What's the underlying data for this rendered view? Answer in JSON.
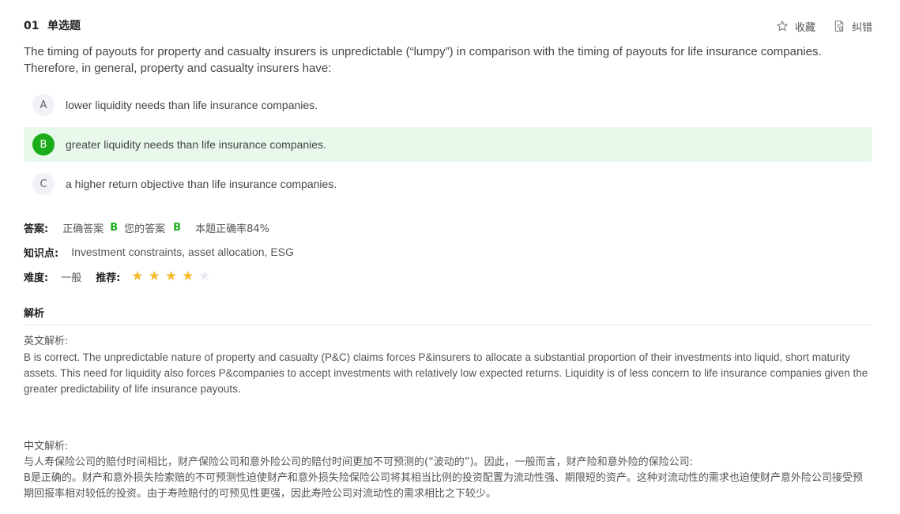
{
  "header": {
    "question_number": "01",
    "question_type": "单选题",
    "favorite_label": "收藏",
    "report_error_label": "纠错"
  },
  "question": {
    "stem": "The timing of payouts for property and casualty insurers is unpredictable (“lumpy”) in comparison with the timing of payouts for life insurance companies. Therefore, in general, property and casualty insurers have:"
  },
  "options": [
    {
      "letter": "A",
      "text": "lower liquidity needs than life insurance companies."
    },
    {
      "letter": "B",
      "text": "greater liquidity needs than life insurance companies."
    },
    {
      "letter": "C",
      "text": "a higher return objective than life insurance companies."
    }
  ],
  "answer": {
    "label": "答案:",
    "correct_label": "正确答案",
    "correct_value": "B",
    "your_label": "您的答案",
    "your_value": "B",
    "accuracy": "本题正确率84%"
  },
  "knowledge": {
    "label": "知识点:",
    "value": "Investment constraints, asset allocation, ESG"
  },
  "difficulty": {
    "label": "难度:",
    "value": "一般",
    "recommend_label": "推荐:",
    "stars_filled": 4,
    "stars_total": 5
  },
  "colors": {
    "accent_green": "#1aad19",
    "correct_bg": "#e8f8ea",
    "star_gold": "#f5b92e",
    "star_empty": "#e8ecf1"
  },
  "analysis": {
    "title": "解析",
    "english_label": "英文解析:",
    "english_text": "B is correct. The unpredictable nature of property and casualty (P&C) claims forces P&insurers to allocate a substantial proportion of their investments into liquid, short maturity assets. This need for liquidity also forces P&companies to accept investments with relatively low expected returns. Liquidity is of less concern to life insurance companies given the greater predictability of life insurance payouts.",
    "chinese_label": "中文解析:",
    "chinese_line1": "与人寿保险公司的赔付时间相比，财产保险公司和意外险公司的赔付时间更加不可预测的(“波动的”)。因此，一般而言，财产险和意外险的保险公司:",
    "chinese_line2": "B是正确的。财产和意外损失险索赔的不可预测性迫使财产和意外损失险保险公司将其相当比例的投资配置为流动性强、期限短的资产。这种对流动性的需求也迫使财产意外险公司接受预期回报率相对较低的投资。由于寿险赔付的可预见性更强，因此寿险公司对流动性的需求相比之下较少。"
  }
}
